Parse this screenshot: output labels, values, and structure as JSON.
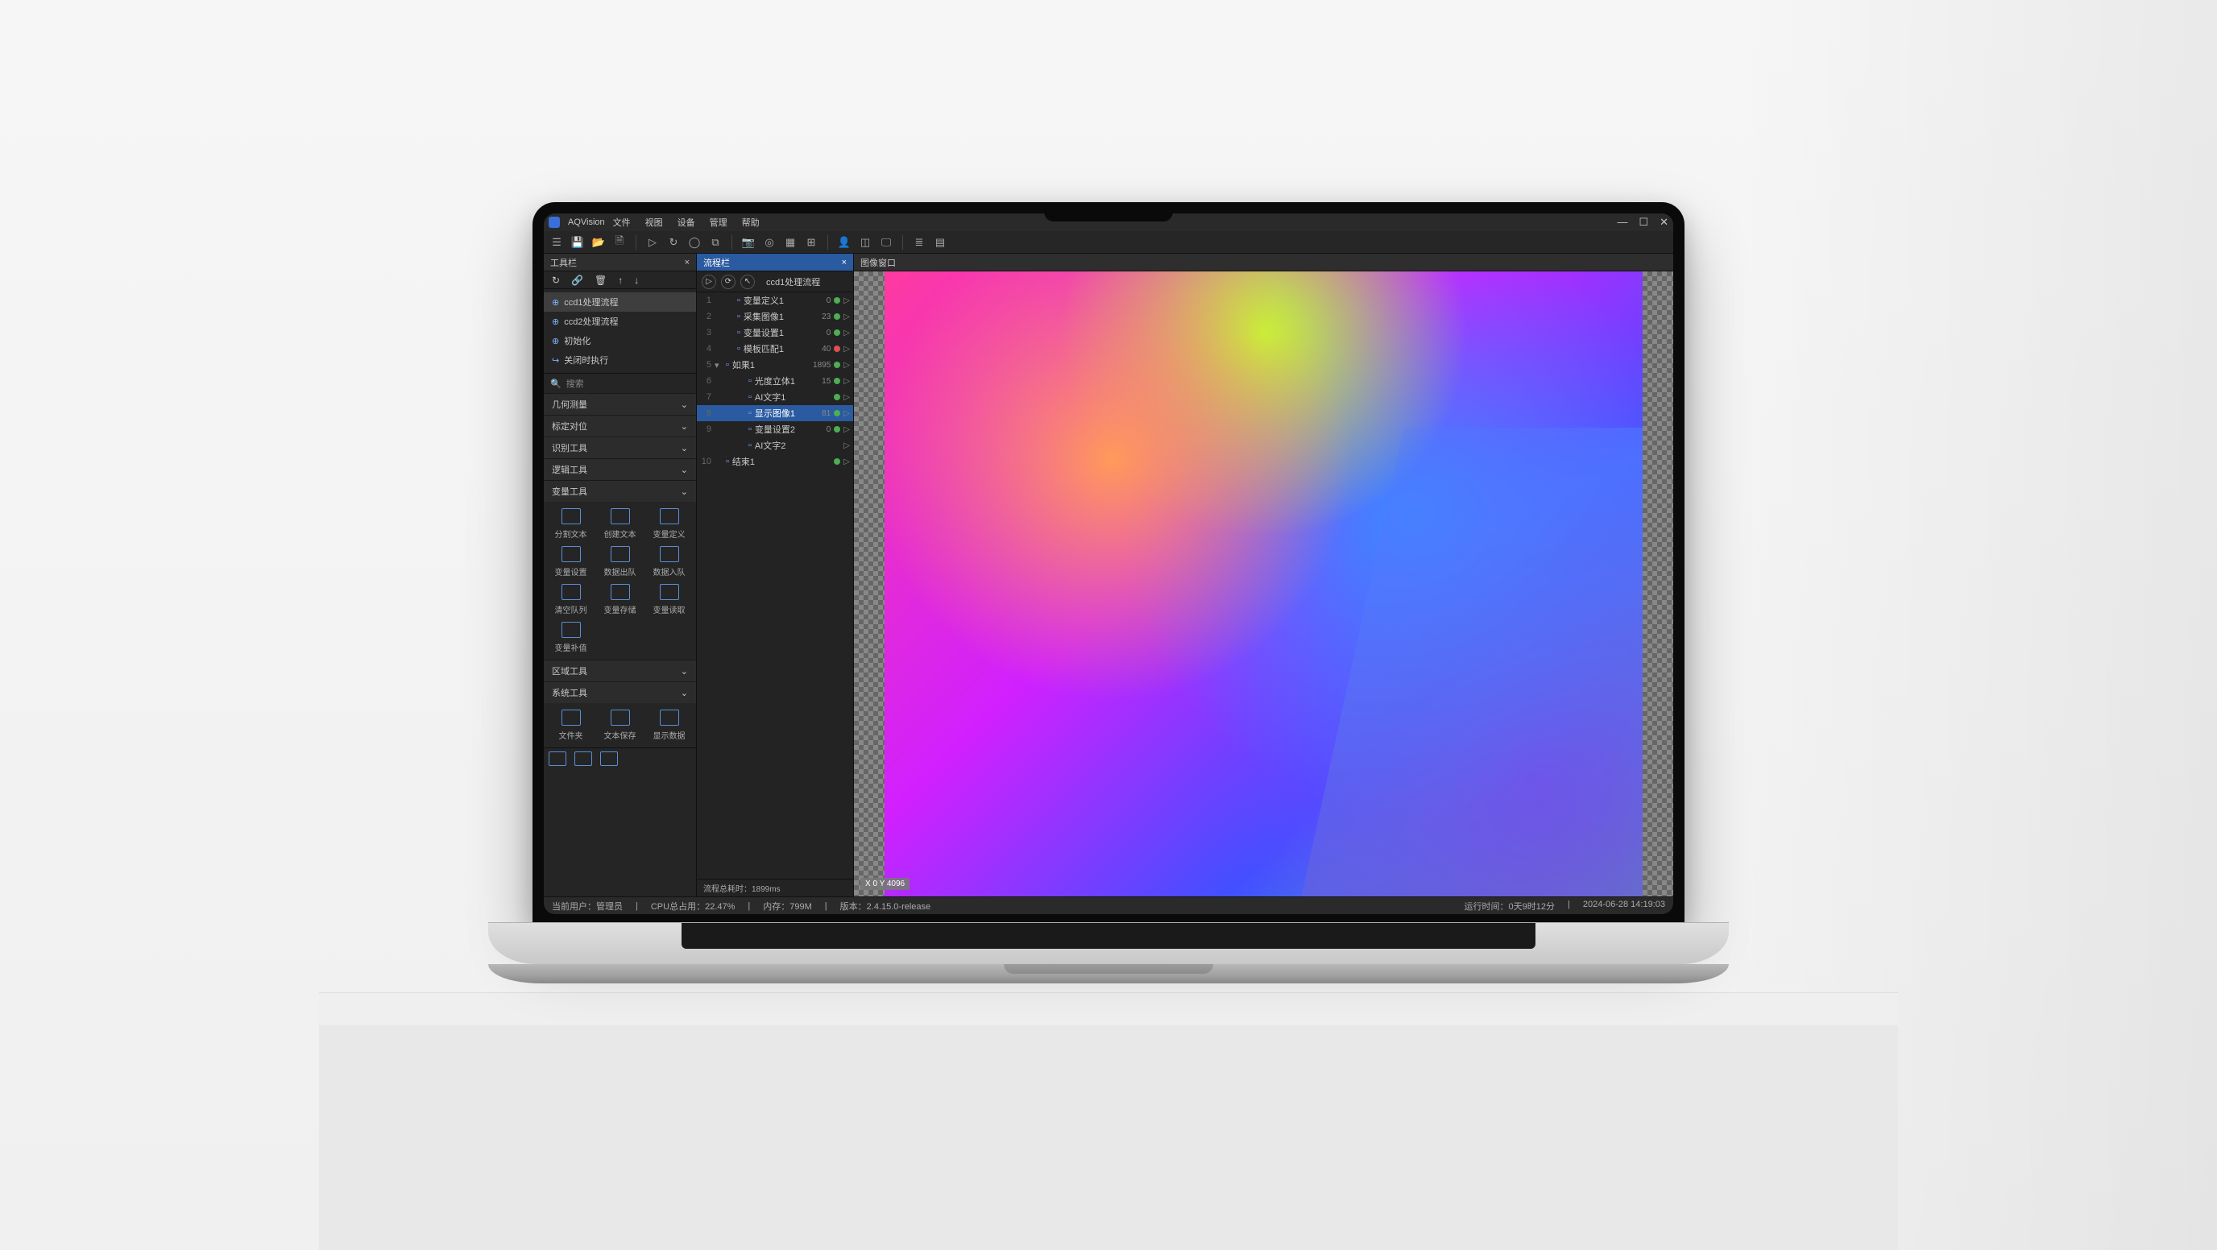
{
  "app": {
    "name": "AQVision"
  },
  "menu": [
    "文件",
    "视图",
    "设备",
    "管理",
    "帮助"
  ],
  "panels": {
    "left_tab": "工具栏",
    "mid_tab": "流程栏",
    "right_tab": "图像窗口"
  },
  "processes": [
    {
      "label": "ccd1处理流程",
      "selected": true
    },
    {
      "label": "ccd2处理流程",
      "selected": false
    },
    {
      "label": "初始化",
      "selected": false
    },
    {
      "label": "关闭时执行",
      "selected": false
    }
  ],
  "search_placeholder": "搜索",
  "categories_collapsed": [
    "几何测量",
    "标定对位",
    "识别工具",
    "逻辑工具"
  ],
  "variable_category": {
    "header": "变量工具",
    "tools": [
      "分割文本",
      "创建文本",
      "变量定义",
      "变量设置",
      "数据出队",
      "数据入队",
      "清空队列",
      "变量存储",
      "变量读取",
      "变量补值"
    ]
  },
  "more_collapsed": [
    "区域工具"
  ],
  "system_category": {
    "header": "系统工具",
    "tools": [
      "文件夹",
      "文本保存",
      "显示数据"
    ]
  },
  "mid_title": "ccd1处理流程",
  "tree": [
    {
      "n": 1,
      "label": "变量定义1",
      "ms": "0",
      "dot": "green",
      "indent": 1
    },
    {
      "n": 2,
      "label": "采集图像1",
      "ms": "23",
      "dot": "green",
      "indent": 1
    },
    {
      "n": 3,
      "label": "变量设置1",
      "ms": "0",
      "dot": "green",
      "indent": 1
    },
    {
      "n": 4,
      "label": "模板匹配1",
      "ms": "40",
      "dot": "red",
      "indent": 1
    },
    {
      "n": 5,
      "label": "如果1",
      "ms": "1895",
      "dot": "green",
      "indent": 0,
      "caret": "▾"
    },
    {
      "n": 6,
      "label": "光度立体1",
      "ms": "15",
      "dot": "green",
      "indent": 2
    },
    {
      "n": 7,
      "label": "AI文字1",
      "ms": "",
      "dot": "green",
      "indent": 2
    },
    {
      "n": 8,
      "label": "显示图像1",
      "ms": "81",
      "dot": "green",
      "indent": 2,
      "sel": true
    },
    {
      "n": 9,
      "label": "变量设置2",
      "ms": "0",
      "dot": "green",
      "indent": 2
    },
    {
      "n": "",
      "label": "AI文字2",
      "ms": "",
      "dot": "",
      "indent": 2
    },
    {
      "n": 10,
      "label": "结束1",
      "ms": "",
      "dot": "green",
      "indent": 0
    }
  ],
  "flow_timer": "流程总耗时：1899ms",
  "coord": "X 0 Y 4096",
  "status": {
    "user_label": "当前用户：",
    "user_value": "管理员",
    "cpu_label": "CPU总占用：",
    "cpu_value": "22.47%",
    "mem_label": "内存：",
    "mem_value": "799M",
    "ver_label": "版本：",
    "ver_value": "2.4.15.0-release",
    "uptime_label": "运行时间：",
    "uptime_value": "0天9时12分",
    "clock": "2024-06-28 14:19:03"
  }
}
